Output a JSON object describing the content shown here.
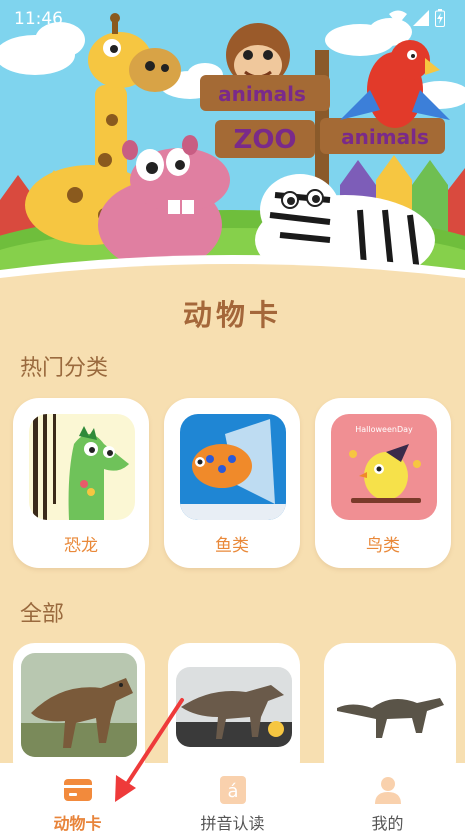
{
  "status_bar": {
    "time": "11:46",
    "icons": [
      "wifi-icon",
      "signal-icon",
      "battery-icon"
    ]
  },
  "banner": {
    "signs": [
      "animals",
      "ZOO",
      "animals"
    ]
  },
  "page_title": "动物卡",
  "hot_categories": {
    "title": "热门分类",
    "items": [
      {
        "label": "恐龙",
        "image": "dinosaur-illustration"
      },
      {
        "label": "鱼类",
        "image": "fish-illustration"
      },
      {
        "label": "鸟类",
        "image": "bird-illustration",
        "caption": "HalloweenDay"
      }
    ]
  },
  "all": {
    "title": "全部",
    "items": [
      {
        "image": "tyrannosaurus-photo"
      },
      {
        "image": "allosaurus-photo"
      },
      {
        "image": "sauropod-photo"
      }
    ]
  },
  "bottom_nav": {
    "items": [
      {
        "label": "动物卡",
        "icon": "card-icon",
        "active": true
      },
      {
        "label": "拼音认读",
        "icon": "pinyin-icon",
        "active": false,
        "glyph": "á"
      },
      {
        "label": "我的",
        "icon": "user-icon",
        "active": false
      }
    ]
  },
  "colors": {
    "accent": "#e8843a",
    "background": "#f7dfb1",
    "title": "#a4673a"
  }
}
